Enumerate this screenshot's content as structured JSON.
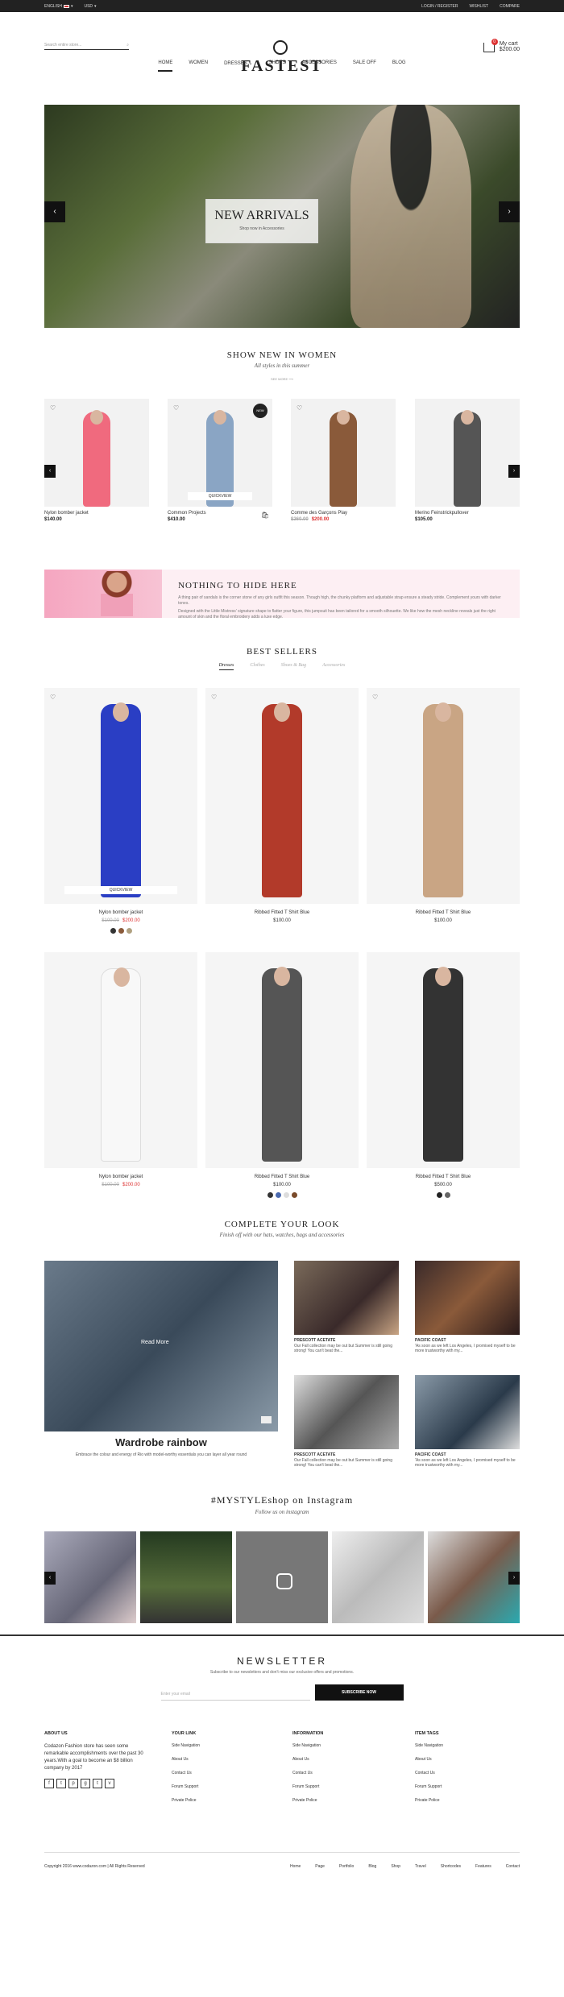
{
  "topbar": {
    "language": "ENGLISH",
    "currency": "USD",
    "login": "LOGIN / REGISTER",
    "wishlist": "WISHLIST",
    "compare": "COMPARE"
  },
  "header": {
    "search_placeholder": "Search entire store...",
    "logo": "FASTEST",
    "cart_label": "My cart",
    "cart_total": "$200.00",
    "cart_count": "0"
  },
  "nav": [
    "HOME",
    "WOMEN",
    "DRESSES",
    "SHOES",
    "ACCESSORIES",
    "SALE OFF",
    "BLOG"
  ],
  "hero": {
    "title": "NEW ARRIVALS",
    "subtitle": "Shop now in Accessories"
  },
  "show_new": {
    "title": "SHOW NEW IN WOMEN",
    "subtitle": "All styles in this summer",
    "see_more": "SEE MORE",
    "products": [
      {
        "name": "Nylon bomber jacket",
        "price": "$140.00",
        "dress": "#f06a7e"
      },
      {
        "name": "Common Projects",
        "price": "$410.00",
        "dress": "#8aa5c4",
        "badge": "NEW",
        "quickview": "QUICKVIEW"
      },
      {
        "name": "Comme des Garçons Play",
        "price_old": "$260.00",
        "price": "$200.00",
        "dress": "#8a5a3a"
      },
      {
        "name": "Merino Feinstrickpullover",
        "price": "$105.00",
        "dress": "#555"
      }
    ]
  },
  "banner": {
    "title": "NOTHING TO HIDE HERE",
    "desc1": "A thing pair of sandals is the corner stone of any girls outfit this season. Though high, the chunky platform and adjustable strap ensure a steady stride. Complement yours with darker tones.",
    "desc2": "Designed with the Little Mistress' signature shape to flatter your figure, this jumpsuit has been tailored for a smooth silhouette. We like how the mesh neckline reveals just the right amount of skin and the floral embroidery adds a luxe edge."
  },
  "best_sellers": {
    "title": "BEST SELLERS",
    "tabs": [
      "Dresses",
      "Clothes",
      "Shoes & Bag",
      "Accessories"
    ],
    "products": [
      {
        "name": "Nylon bomber jacket",
        "price_old": "$100.00",
        "price": "$200.00",
        "dress": "#2a3ec4",
        "quickview": "QUICKVIEW"
      },
      {
        "name": "Ribbed Fitted T Shirt Blue",
        "price": "$100.00",
        "dress": "#b23a2a"
      },
      {
        "name": "Ribbed Fitted T Shirt Blue",
        "price": "$100.00",
        "dress": "#c9a584"
      },
      {
        "name": "Nylon bomber jacket",
        "price_old": "$100.00",
        "price": "$200.00",
        "dress": "#f0f0f0"
      },
      {
        "name": "Ribbed Fitted T Shirt Blue",
        "price": "$100.00",
        "dress": "#555"
      },
      {
        "name": "Ribbed Fitted T Shirt Blue",
        "price": "$500.00",
        "dress": "#333"
      }
    ]
  },
  "complete_look": {
    "title": "COMPLETE YOUR LOOK",
    "subtitle": "Finish off with our hats, watches, bags and accessories",
    "big": {
      "read_more": "Read More",
      "title": "Wardrobe rainbow",
      "desc": "Embrace the colour and energy of Rio with model-worthy essentials you can layer all year round"
    },
    "items": [
      {
        "title": "PRESCOTT ACETATE",
        "desc": "Our Fall collection may be out but Summer is still going strong! You can't beat the..."
      },
      {
        "title": "PACIFIC COAST",
        "desc": "'As soon as we left Los Angeles, I promised myself to be more trustworthy with my..."
      },
      {
        "title": "PRESCOTT ACETATE",
        "desc": "Our Fall collection may be out but Summer is still going strong! You can't beat the..."
      },
      {
        "title": "PACIFIC COAST",
        "desc": "'As soon as we left Los Angeles, I promised myself to be more trustworthy with my..."
      }
    ]
  },
  "instagram": {
    "title": "#MYSTYLEshop on Instagram",
    "subtitle": "Follow us on instagram"
  },
  "newsletter": {
    "title": "NEWSLETTER",
    "subtitle": "Subscribe to our newsletters and don't miss our exclusive offers and promotions.",
    "placeholder": "Enter your email",
    "button": "SUBSCRIBE NOW"
  },
  "footer": {
    "about_title": "ABOUT US",
    "about_text": "Codazon Fashion store has seen some remarkable accomplishments over the past 30 years.With a goal to become an $8 billion company by 2017",
    "your_link_title": "YOUR LINK",
    "your_links": [
      "Side Navigation",
      "About Us",
      "Contact Us",
      "Forum Support",
      "Private Police"
    ],
    "info_title": "INFORMATION",
    "info_links": [
      "Side Navigation",
      "About Us",
      "Contact Us",
      "Forum Support",
      "Private Police"
    ],
    "tags_title": "ITEM TAGS",
    "tags_links": [
      "Side Navigation",
      "About Us",
      "Contact Us",
      "Forum Support",
      "Private Police"
    ],
    "copyright": "Copyright 2016  www.codazon.com | All Rights Reserved",
    "bottom_links": [
      "Home",
      "Page",
      "Portfolio",
      "Blog",
      "Shop",
      "Travel",
      "Shortcodes",
      "Features",
      "Contact"
    ]
  }
}
